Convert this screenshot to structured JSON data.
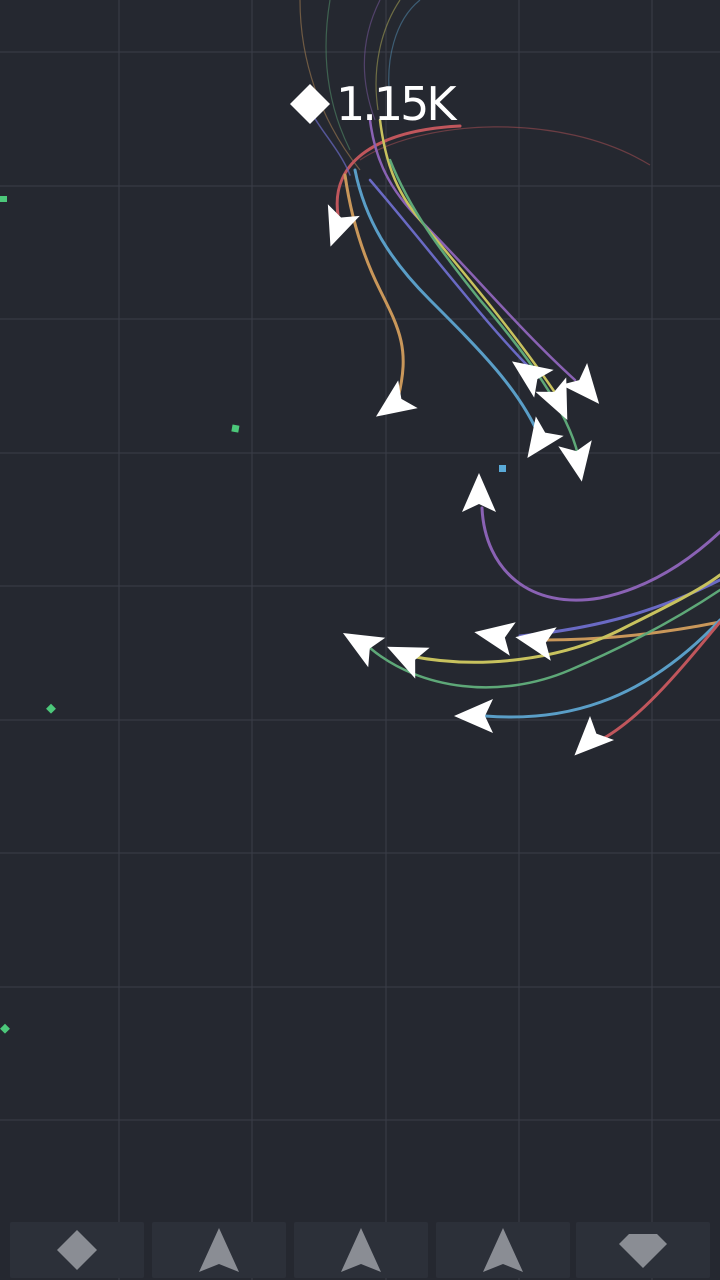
{
  "hud": {
    "currency_icon": "diamond-gem-icon",
    "currency_value": "1.15K"
  },
  "toolbar": {
    "slots": [
      {
        "icon": "diamond-icon"
      },
      {
        "icon": "arrow-ship-icon"
      },
      {
        "icon": "arrow-ship-icon"
      },
      {
        "icon": "arrow-ship-icon"
      },
      {
        "icon": "gem-icon"
      }
    ]
  },
  "colors": {
    "background": "#252830",
    "grid": "#3a3e48",
    "ship": "#ffffff",
    "trail_red": "#c0565c",
    "trail_orange": "#c9975a",
    "trail_blue": "#5a9ec7",
    "trail_purple": "#8a62b4",
    "trail_indigo": "#6a6ac4",
    "trail_yellow": "#c8c25e",
    "trail_green": "#5ea878",
    "pickup_green": "#4cc87a",
    "pickup_blue": "#5aaad8",
    "toolbar_slot": "#2c3039",
    "toolbar_icon": "#8a8d94"
  }
}
